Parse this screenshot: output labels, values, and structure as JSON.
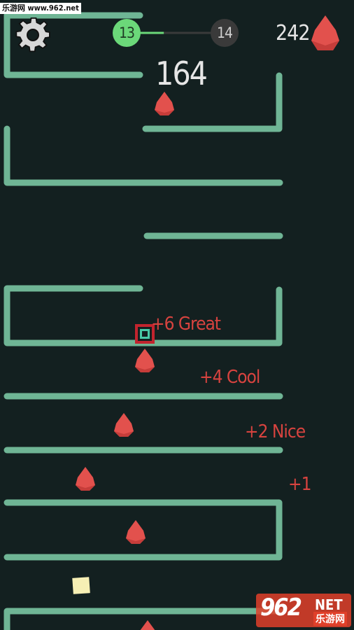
{
  "watermark": {
    "site_text": "乐游网 www.962.net",
    "logo_number": "962",
    "logo_net": "NET",
    "logo_sub": "乐游网"
  },
  "hud": {
    "settings_icon": "gear-icon",
    "level_current": "13",
    "level_next": "14",
    "level_progress": 0.35,
    "gem_count": "242",
    "gem_icon": "drop-icon",
    "score": "164"
  },
  "popups": [
    "+6 Great",
    "+4 Cool",
    "+2 Nice",
    "+1"
  ],
  "colors": {
    "background": "#132020",
    "wall": "#6fb595",
    "drop": "#e2514d",
    "level_done": "#6bd879",
    "level_pending": "#3a3a3a",
    "player_outline": "#c2242e",
    "player_core": "#48c9a6",
    "block": "#f6efb4",
    "popup_text": "#d7433f"
  }
}
